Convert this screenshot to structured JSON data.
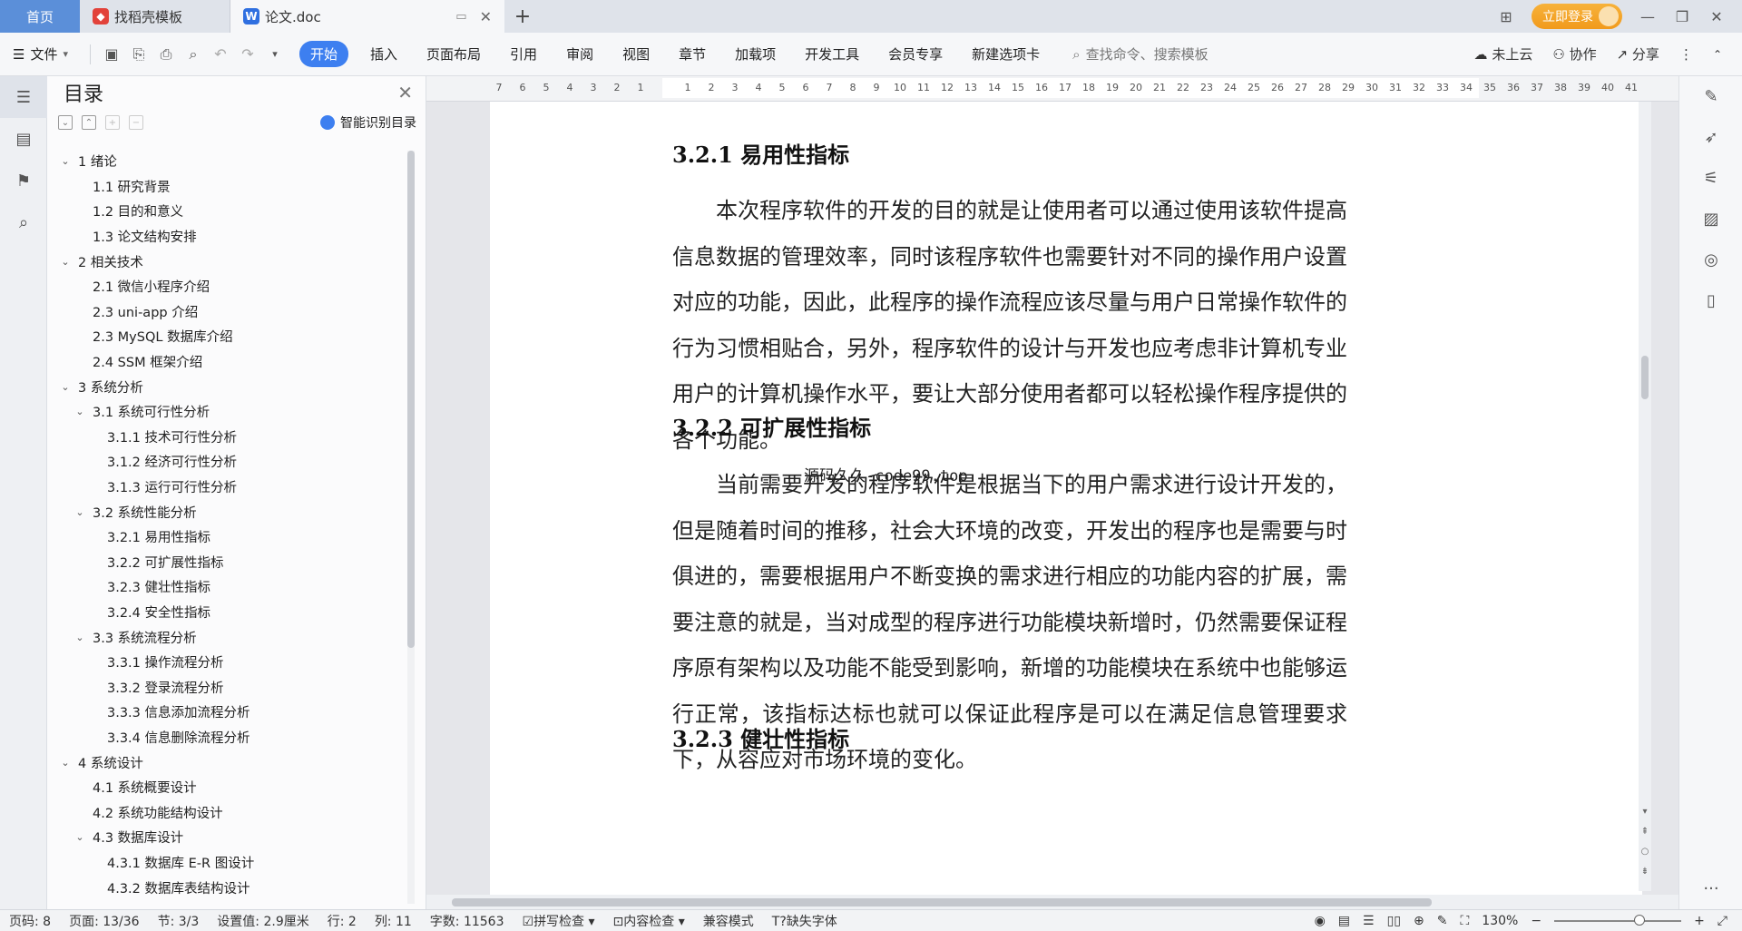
{
  "tabs": [
    {
      "label": "首页"
    },
    {
      "label": "找稻壳模板",
      "icon": "docer-icon"
    },
    {
      "label": "论文.doc",
      "icon": "word-doc-icon"
    }
  ],
  "header": {
    "login_label": "立即登录"
  },
  "menu": {
    "file_label": "文件",
    "items": [
      "开始",
      "插入",
      "页面布局",
      "引用",
      "审阅",
      "视图",
      "章节",
      "加载项",
      "开发工具",
      "会员专享",
      "新建选项卡"
    ],
    "search_placeholder": "查找命令、搜索模板",
    "cloud_label": "未上云",
    "collab_label": "协作",
    "share_label": "分享"
  },
  "toc": {
    "title": "目录",
    "smart_label": "智能识别目录",
    "items": [
      {
        "label": "1  绪论",
        "level": 1,
        "expandable": true
      },
      {
        "label": "1.1  研究背景",
        "level": 2
      },
      {
        "label": "1.2  目的和意义",
        "level": 2
      },
      {
        "label": "1.3  论文结构安排",
        "level": 2
      },
      {
        "label": "2  相关技术",
        "level": 1,
        "expandable": true
      },
      {
        "label": "2.1  微信小程序介绍",
        "level": 2
      },
      {
        "label": "2.3  uni-app 介绍",
        "level": 2
      },
      {
        "label": "2.3  MySQL 数据库介绍",
        "level": 2
      },
      {
        "label": "2.4  SSM 框架介绍",
        "level": 2
      },
      {
        "label": "3  系统分析",
        "level": 1,
        "expandable": true
      },
      {
        "label": "3.1  系统可行性分析",
        "level": 2,
        "expandable": true
      },
      {
        "label": "3.1.1  技术可行性分析",
        "level": 3
      },
      {
        "label": "3.1.2  经济可行性分析",
        "level": 3
      },
      {
        "label": "3.1.3  运行可行性分析",
        "level": 3
      },
      {
        "label": "3.2  系统性能分析",
        "level": 2,
        "expandable": true
      },
      {
        "label": "3.2.1  易用性指标",
        "level": 3
      },
      {
        "label": "3.2.2  可扩展性指标",
        "level": 3
      },
      {
        "label": "3.2.3  健壮性指标",
        "level": 3
      },
      {
        "label": "3.2.4  安全性指标",
        "level": 3
      },
      {
        "label": "3.3  系统流程分析",
        "level": 2,
        "expandable": true
      },
      {
        "label": "3.3.1  操作流程分析",
        "level": 3
      },
      {
        "label": "3.3.2  登录流程分析",
        "level": 3
      },
      {
        "label": "3.3.3  信息添加流程分析",
        "level": 3
      },
      {
        "label": "3.3.4  信息删除流程分析",
        "level": 3
      },
      {
        "label": "4  系统设计",
        "level": 1,
        "expandable": true
      },
      {
        "label": "4.1  系统概要设计",
        "level": 2
      },
      {
        "label": "4.2  系统功能结构设计",
        "level": 2
      },
      {
        "label": "4.3  数据库设计",
        "level": 2,
        "expandable": true
      },
      {
        "label": "4.3.1  数据库 E-R 图设计",
        "level": 3
      },
      {
        "label": "4.3.2  数据库表结构设计",
        "level": 3
      }
    ]
  },
  "ruler": {
    "ticks": [
      "7",
      "6",
      "5",
      "4",
      "3",
      "2",
      "1",
      "",
      "1",
      "2",
      "3",
      "4",
      "5",
      "6",
      "7",
      "8",
      "9",
      "10",
      "11",
      "12",
      "13",
      "14",
      "15",
      "16",
      "17",
      "18",
      "19",
      "20",
      "21",
      "22",
      "23",
      "24",
      "25",
      "26",
      "27",
      "28",
      "29",
      "30",
      "31",
      "32",
      "33",
      "34",
      "35",
      "36",
      "37",
      "38",
      "39",
      "40",
      "41"
    ]
  },
  "document": {
    "h1": "3.2.1  易用性指标",
    "p1": "本次程序软件的开发的目的就是让使用者可以通过使用该软件提高信息数据的管理效率，同时该程序软件也需要针对不同的操作用户设置对应的功能，因此，此程序的操作流程应该尽量与用户日常操作软件的行为习惯相贴合，另外，程序软件的设计与开发也应考虑非计算机专业用户的计算机操作水平，要让大部分使用者都可以轻松操作程序提供的各个功能。",
    "watermark": "源码久久-code99.top",
    "h2": "3.2.2  可扩展性指标",
    "p2": "当前需要开发的程序软件是根据当下的用户需求进行设计开发的，但是随着时间的推移，社会大环境的改变，开发出的程序也是需要与时俱进的，需要根据用户不断变换的需求进行相应的功能内容的扩展，需要注意的就是，当对成型的程序进行功能模块新增时，仍然需要保证程序原有架构以及功能不能受到影响，新增的功能模块在系统中也能够运行正常，该指标达标也就可以保证此程序是可以在满足信息管理要求下，从容应对市场环境的变化。",
    "h3": "3.2.3  健壮性指标"
  },
  "status": {
    "page_code": "页码: 8",
    "page": "页面: 13/36",
    "section": "节: 3/3",
    "setting": "设置值: 2.9厘米",
    "row": "行: 2",
    "col": "列: 11",
    "words": "字数: 11563",
    "spell": "拼写检查",
    "content_check": "内容检查",
    "compat": "兼容模式",
    "missing_font": "缺失字体",
    "zoom": "130%"
  },
  "colors": {
    "accent": "#3d7ff0",
    "home_tab": "#5b8fd9",
    "login": "#f19a1c"
  }
}
